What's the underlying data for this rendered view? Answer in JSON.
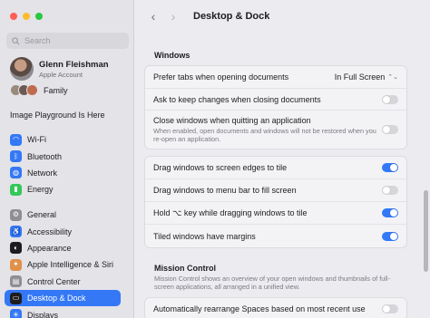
{
  "sidebar": {
    "search_placeholder": "Search",
    "account": {
      "name": "Glenn Fleishman",
      "subtitle": "Apple Account"
    },
    "family_label": "Family",
    "promo": "Image Playground Is Here",
    "group1": [
      {
        "label": "Wi-Fi",
        "icon": "wifi-icon",
        "color": "#3478f6",
        "glyph": "◠"
      },
      {
        "label": "Bluetooth",
        "icon": "bluetooth-icon",
        "color": "#3478f6",
        "glyph": "ᛒ"
      },
      {
        "label": "Network",
        "icon": "globe-icon",
        "color": "#3478f6",
        "glyph": "◍"
      },
      {
        "label": "Energy",
        "icon": "battery-icon",
        "color": "#34c759",
        "glyph": "▮"
      }
    ],
    "group2": [
      {
        "label": "General",
        "icon": "gear-icon",
        "color": "#8e8e93",
        "glyph": "⚙"
      },
      {
        "label": "Accessibility",
        "icon": "accessibility-icon",
        "color": "#3478f6",
        "glyph": "♿"
      },
      {
        "label": "Appearance",
        "icon": "appearance-icon",
        "color": "#1d1d1f",
        "glyph": "◐"
      },
      {
        "label": "Apple Intelligence & Siri",
        "icon": "siri-icon",
        "color": "#e0904a",
        "glyph": "✦"
      },
      {
        "label": "Control Center",
        "icon": "control-center-icon",
        "color": "#8e8e93",
        "glyph": "▤"
      },
      {
        "label": "Desktop & Dock",
        "icon": "desktop-dock-icon",
        "color": "#1d1d1f",
        "glyph": "▭",
        "selected": true
      },
      {
        "label": "Displays",
        "icon": "display-icon",
        "color": "#3478f6",
        "glyph": "☀"
      }
    ]
  },
  "toolbar": {
    "back": "‹",
    "forward": "›",
    "title": "Desktop & Dock"
  },
  "windows": {
    "title": "Windows",
    "prefer_tabs": {
      "label": "Prefer tabs when opening documents",
      "value": "In Full Screen"
    },
    "ask_keep": {
      "label": "Ask to keep changes when closing documents",
      "on": false
    },
    "close_windows": {
      "label": "Close windows when quitting an application",
      "desc": "When enabled, open documents and windows will not be restored when you re-open an application.",
      "on": false
    }
  },
  "tiling": [
    {
      "label": "Drag windows to screen edges to tile",
      "on": true
    },
    {
      "label": "Drag windows to menu bar to fill screen",
      "on": false
    },
    {
      "label": "Hold ⌥ key while dragging windows to tile",
      "on": true
    },
    {
      "label": "Tiled windows have margins",
      "on": true
    }
  ],
  "mission_control": {
    "title": "Mission Control",
    "desc": "Mission Control shows an overview of your open windows and thumbnails of full-screen applications, all arranged in a unified view.",
    "rearrange": {
      "label": "Automatically rearrange Spaces based on most recent use",
      "on": false
    }
  }
}
